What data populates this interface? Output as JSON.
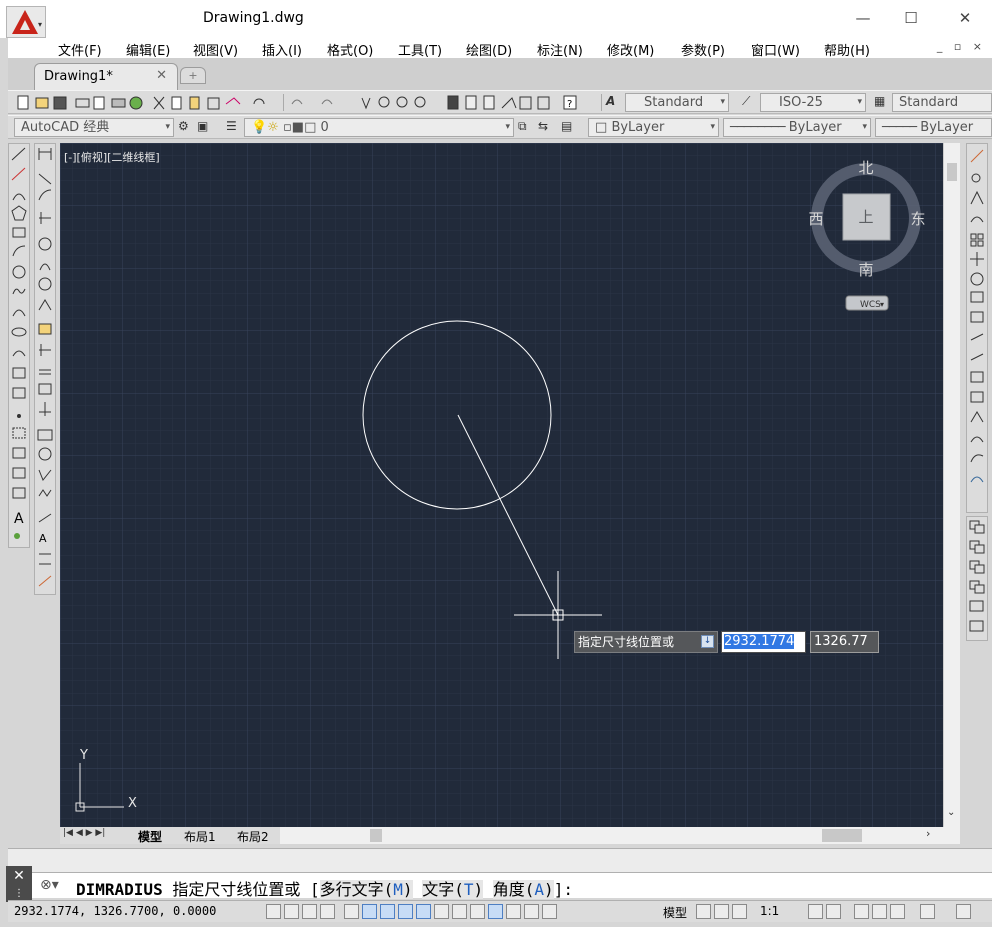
{
  "window": {
    "title": "Drawing1.dwg",
    "controls": [
      "—",
      "☐",
      "✕"
    ],
    "mdi_controls": "_ ▫ ×"
  },
  "menu": [
    "文件(F)",
    "编辑(E)",
    "视图(V)",
    "插入(I)",
    "格式(O)",
    "工具(T)",
    "绘图(D)",
    "标注(N)",
    "修改(M)",
    "参数(P)",
    "窗口(W)",
    "帮助(H)"
  ],
  "doc_tab": {
    "label": "Drawing1*",
    "close": "✕",
    "new_tab": "+"
  },
  "toolbar1": {
    "text_style": "Standard",
    "dim_style": "ISO-25",
    "table_style": "Standard"
  },
  "toolbar2": {
    "workspace": "AutoCAD 经典",
    "layer": "0",
    "color": "ByLayer",
    "linetype": "ByLayer",
    "lineweight": "ByLayer"
  },
  "viewport": {
    "label": "[-][俯视][二维线框]",
    "compass": {
      "north": "北",
      "south": "南",
      "west": "西",
      "east": "东",
      "top": "上"
    },
    "wcs": "WCS",
    "ucs_x": "X",
    "ucs_y": "Y"
  },
  "dynamic_input": {
    "prompt": "指定尺寸线位置或",
    "x_value": "2932.1774",
    "y_value": "1326.77",
    "options_icon": "arrow-down-icon"
  },
  "layout_tabs": [
    "模型",
    "布局1",
    "布局2"
  ],
  "command": {
    "close": "✕",
    "history_icon": "wrench-icon",
    "name": "DIMRADIUS",
    "prompt": "指定尺寸线位置或",
    "open_bracket": "[",
    "options": [
      {
        "text": "多行文字(",
        "key": "M",
        "close": ")"
      },
      {
        "text": "文字(",
        "key": "T",
        "close": ")"
      },
      {
        "text": "角度(",
        "key": "A",
        "close": ")"
      }
    ],
    "end": "]:"
  },
  "status": {
    "coords": "2932.1774, 1326.7700, 0.0000",
    "model_label": "模型",
    "scale": "1:1"
  },
  "colors": {
    "canvas": "#212a3a",
    "grid_minor": "#2b3446",
    "grid_major": "#37435a",
    "highlight": "#3178e3",
    "logo": "#c8241a"
  }
}
